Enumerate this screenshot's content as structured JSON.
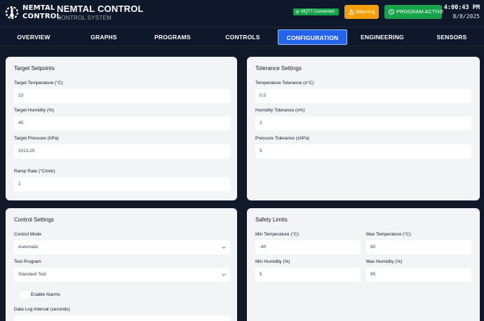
{
  "header": {
    "logo_text_line1": "NEMTAL",
    "logo_text_line2": "CONTROL",
    "title": "NEMTAL CONTROL",
    "subtitle": "CONTROL SYSTEM",
    "mqtt_status": "MQTT Connected",
    "warning_label": "Warning",
    "program_status": "PROGRAM ACTIVE",
    "time": "4:00:43 PM",
    "date": "8/8/2025"
  },
  "nav": {
    "tabs": [
      "OVERVIEW",
      "GRAPHS",
      "PROGRAMS",
      "CONTROLS",
      "CONFIGURATION",
      "ENGINEERING",
      "SENSORS"
    ],
    "active": "CONFIGURATION"
  },
  "target_setpoints": {
    "title": "Target Setpoints",
    "target_temperature_label": "Target Temperature (°C)",
    "target_temperature_value": "23",
    "target_humidity_label": "Target Humidity (%)",
    "target_humidity_value": "45",
    "target_pressure_label": "Target Pressure (hPa)",
    "target_pressure_value": "1013.25",
    "ramp_rate_label": "Ramp Rate (°C/min)",
    "ramp_rate_value": "1"
  },
  "tolerance_settings": {
    "title": "Tolerance Settings",
    "temperature_tolerance_label": "Temperature Tolerance (±°C)",
    "temperature_tolerance_value": "0.5",
    "humidity_tolerance_label": "Humidity Tolerance (±%)",
    "humidity_tolerance_value": "2",
    "pressure_tolerance_label": "Pressure Tolerance (±hPa)",
    "pressure_tolerance_value": "5"
  },
  "control_settings": {
    "title": "Control Settings",
    "control_mode_label": "Control Mode",
    "control_mode_value": "Automatic",
    "test_program_label": "Test Program",
    "test_program_value": "Standard Test",
    "enable_alarms_label": "Enable Alarms",
    "data_log_interval_label": "Data Log Interval (seconds)"
  },
  "safety_limits": {
    "title": "Safety Limits",
    "min_temperature_label": "Min Temperature (°C)",
    "min_temperature_value": "-40",
    "max_temperature_label": "Max Temperature (°C)",
    "max_temperature_value": "80",
    "min_humidity_label": "Min Humidity (%)",
    "min_humidity_value": "5",
    "max_humidity_label": "Max Humidity (%)",
    "max_humidity_value": "95"
  },
  "colors": {
    "background": "#111827",
    "header": "#0f172a",
    "accent_blue": "#2563eb",
    "status_green": "#16a34a",
    "warning_amber": "#f59e0b",
    "panel": "#f3f4f6"
  },
  "icons": {
    "logo": "gear-thermometer-icon",
    "mqtt": "wifi-icon",
    "warning": "warning-icon",
    "program": "clock-icon",
    "select": "chevron-down-icon"
  }
}
